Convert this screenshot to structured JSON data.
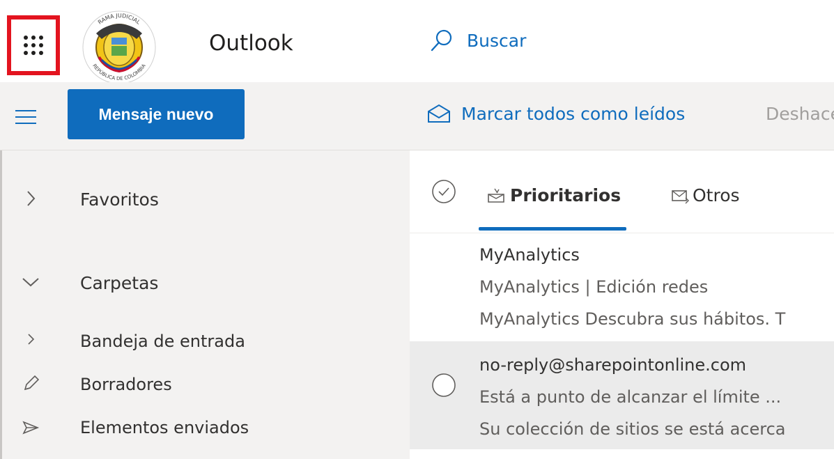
{
  "header": {
    "app_title": "Outlook",
    "search_label": "Buscar",
    "logo_text_top": "RAMA JUDICIAL",
    "logo_text_bottom": "REPÚBLICA DE COLOMBIA",
    "highlight_color": "#e3141f",
    "icons": {
      "launcher": "app-launcher-icon",
      "search": "search-icon"
    }
  },
  "command_bar": {
    "new_message_label": "Mensaje nuevo",
    "mark_all_label": "Marcar todos como leídos",
    "undo_label": "Deshacer",
    "accent_color": "#0f6cbd",
    "icons": {
      "menu": "hamburger-icon",
      "mark_all": "envelope-open-icon",
      "undo": "undo-icon"
    }
  },
  "nav": {
    "favorites_label": "Favoritos",
    "folders_label": "Carpetas",
    "folders": [
      {
        "label": "Bandeja de entrada",
        "icon": "chevron-right-icon"
      },
      {
        "label": "Borradores",
        "icon": "pencil-icon"
      },
      {
        "label": "Elementos enviados",
        "icon": "send-icon"
      }
    ]
  },
  "list": {
    "tabs": [
      {
        "label": "Prioritarios",
        "icon": "focused-inbox-icon",
        "active": true
      },
      {
        "label": "Otros",
        "icon": "other-inbox-icon",
        "active": false
      }
    ],
    "messages": [
      {
        "sender": "MyAnalytics",
        "subject": "MyAnalytics | Edición redes",
        "preview": "MyAnalytics Descubra sus hábitos. T",
        "selected": false
      },
      {
        "sender": "no-reply@sharepointonline.com",
        "subject": "Está a punto de alcanzar el límite ...",
        "preview": "Su colección de sitios se está acerca",
        "selected": true
      }
    ]
  }
}
